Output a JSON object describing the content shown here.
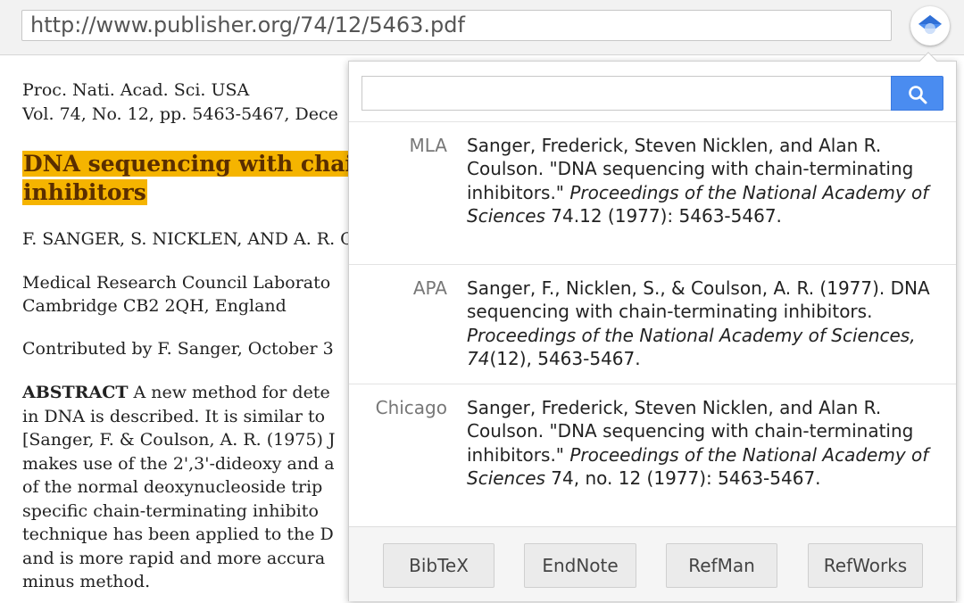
{
  "browser": {
    "url": "http://www.publisher.org/74/12/5463.pdf"
  },
  "document": {
    "journal": "Proc. Nati. Acad. Sci. USA",
    "volume_line": "Vol. 74, No. 12, pp. 5463-5467, Dece",
    "title_line1": "DNA sequencing with chair",
    "title_line2": "inhibitors",
    "authors": "F. SANGER, S. NICKLEN, AND A. R. C",
    "affiliation_line1": "Medical Research Council Laborato",
    "affiliation_line2": "Cambridge CB2 2QH, England",
    "contributed": "Contributed by F. Sanger, October 3",
    "abstract_label": "ABSTRACT",
    "abstract_text": " A new method for dete\nin DNA is described. It is similar to\n[Sanger, F. & Coulson, A. R. (1975) J\nmakes use of the 2',3'-dideoxy and a\nof the normal deoxynucleoside trip\nspecific chain-terminating inhibito\ntechnique has been applied to the D\nand is more rapid and more accura\nminus method."
  },
  "popup": {
    "search": {
      "placeholder": "",
      "value": ""
    },
    "citations": [
      {
        "style": "MLA",
        "before": "Sanger, Frederick, Steven Nicklen, and Alan R. Coulson. \"DNA sequencing with chain-terminating inhibitors.\" ",
        "italic": "Proceedings of the National Academy of Sciences",
        "after": " 74.12 (1977): 5463-5467."
      },
      {
        "style": "APA",
        "before": "Sanger, F., Nicklen, S., & Coulson, A. R. (1977). DNA sequencing with chain-terminating inhibitors. ",
        "italic": "Proceedings of the National Academy of Sciences",
        "italic2": ", 74",
        "after": "(12), 5463-5467."
      },
      {
        "style": "Chicago",
        "before": "Sanger, Frederick, Steven Nicklen, and Alan R. Coulson. \"DNA sequencing with chain-terminating inhibitors.\" ",
        "italic": "Proceedings of the National Academy of Sciences",
        "after": " 74, no. 12 (1977): 5463-5467."
      }
    ],
    "export_buttons": [
      "BibTeX",
      "EndNote",
      "RefMan",
      "RefWorks"
    ]
  },
  "colors": {
    "highlight": "#f5b400",
    "search_button": "#4a8cf0",
    "extension_icon": "#4a8cf0"
  },
  "icons": {
    "extension": "scholar-cap-icon",
    "search": "search-icon"
  }
}
